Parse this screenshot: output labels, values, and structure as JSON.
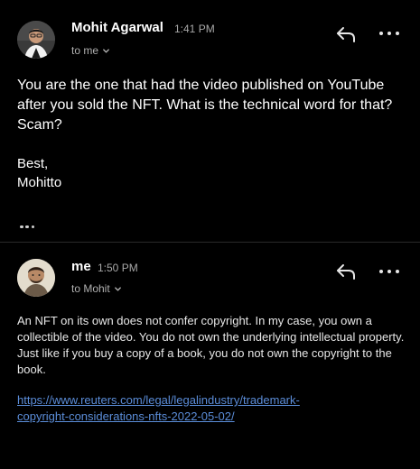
{
  "messages": [
    {
      "sender": "Mohit Agarwal",
      "time": "1:41 PM",
      "recipient": "to me",
      "body": "You are the one that had the video published on YouTube after you sold the NFT. What is the technical word for that? Scam?",
      "signature_line1": "Best,",
      "signature_line2": "Mohitto",
      "avatar_icon": "person-photo-avatar",
      "reply_icon": "reply-arrow-icon",
      "more_icon": "more-horizontal-icon"
    },
    {
      "sender": "me",
      "time": "1:50 PM",
      "recipient": "to Mohit",
      "body": "An NFT on its own does not confer copyright. In my case, you own a collectible of the video. You do not own the underlying intellectual property. Just like if you buy a copy of a book, you do not own the copyright to the book.",
      "link_line1": "https://www.reuters.com/legal/legalindustry/trademark-",
      "link_line2": "copyright-considerations-nfts-2022-05-02/",
      "avatar_icon": "person-photo-avatar",
      "reply_icon": "reply-arrow-icon",
      "more_icon": "more-horizontal-icon"
    }
  ],
  "colors": {
    "background": "#000000",
    "text": "#ffffff",
    "muted": "#a8a8a8",
    "link": "#5b8dd9",
    "divider": "#2a2a2a"
  }
}
